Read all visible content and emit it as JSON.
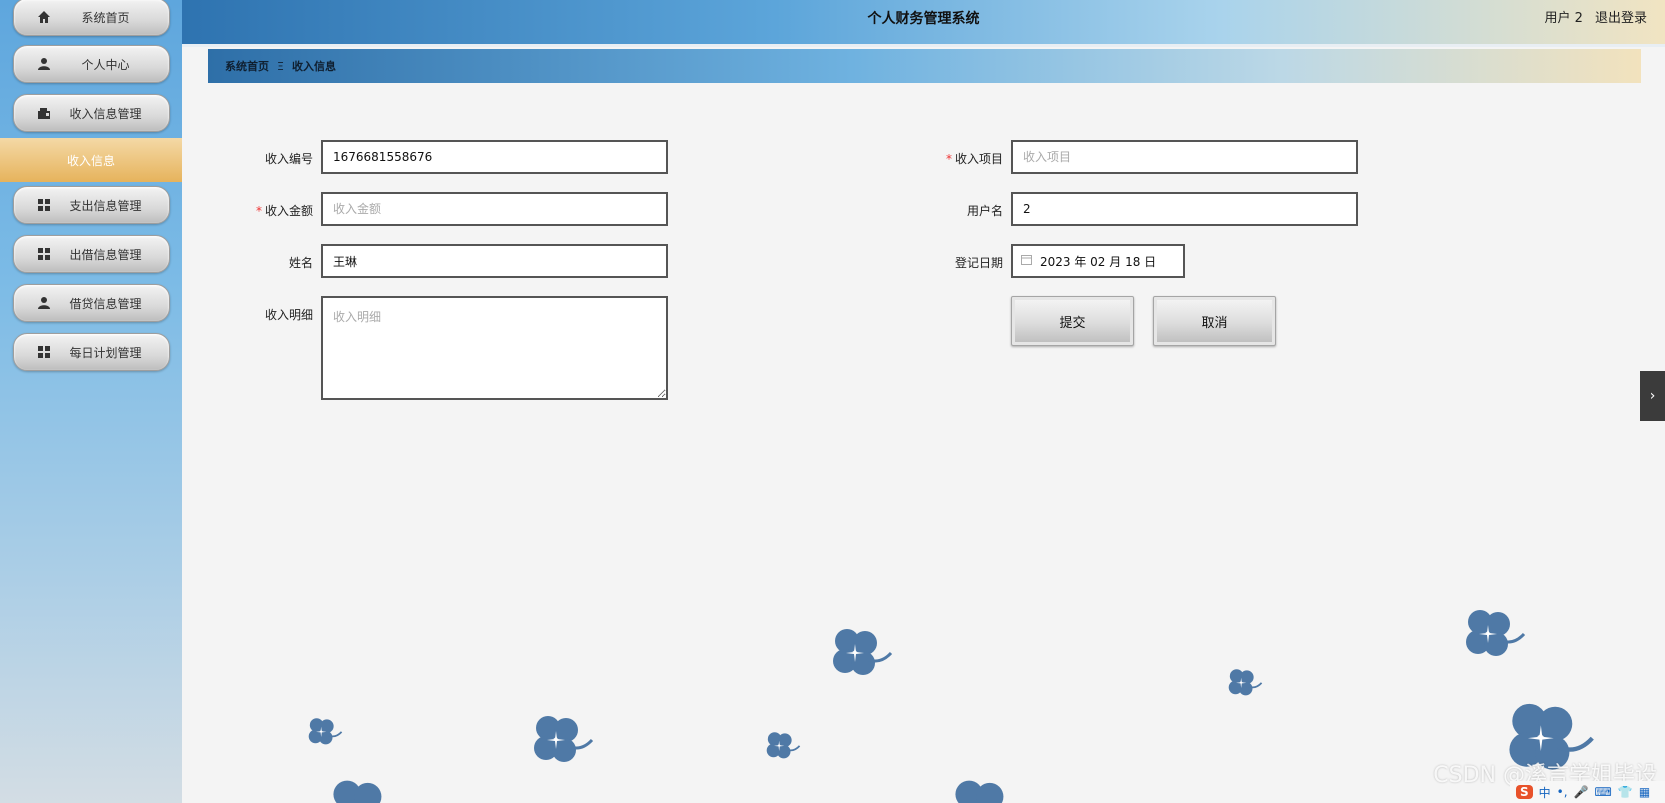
{
  "sidebar": {
    "items": [
      {
        "label": "系统首页",
        "icon": "home-icon"
      },
      {
        "label": "个人中心",
        "icon": "person-icon"
      },
      {
        "label": "收入信息管理",
        "icon": "wallet-icon"
      },
      {
        "label": "支出信息管理",
        "icon": "grid-icon"
      },
      {
        "label": "出借信息管理",
        "icon": "grid-icon"
      },
      {
        "label": "借贷信息管理",
        "icon": "person-icon"
      },
      {
        "label": "每日计划管理",
        "icon": "grid-icon"
      }
    ],
    "active_sub": "收入信息"
  },
  "header": {
    "title": "个人财务管理系统",
    "user_label": "用户 2",
    "logout_label": "退出登录"
  },
  "breadcrumb": {
    "home": "系统首页",
    "separator": "Ξ",
    "current": "收入信息"
  },
  "form": {
    "income_no": {
      "label": "收入编号",
      "value": "1676681558676"
    },
    "income_item": {
      "label": "收入项目",
      "placeholder": "收入项目",
      "required": true
    },
    "income_amount": {
      "label": "收入金额",
      "placeholder": "收入金额",
      "required": true
    },
    "username": {
      "label": "用户名",
      "value": "2"
    },
    "name": {
      "label": "姓名",
      "value": "王琳"
    },
    "reg_date": {
      "label": "登记日期",
      "value": "2023 年 02 月 18 日"
    },
    "detail": {
      "label": "收入明细",
      "placeholder": "收入明细"
    },
    "submit_label": "提交",
    "cancel_label": "取消",
    "required_mark": "*"
  },
  "misc": {
    "side_tab_glyph": "›",
    "watermark": "CSDN @溪言学姐毕设",
    "ime": {
      "logo": "S",
      "lang": "中",
      "punct": "•,",
      "mic": "🎤",
      "keyboard": "⌨",
      "shirt": "👕",
      "grid": "▦"
    }
  },
  "colors": {
    "accent_orange": "#e6b35c",
    "required_red": "#e33333",
    "clover_blue": "#4f79a6"
  }
}
